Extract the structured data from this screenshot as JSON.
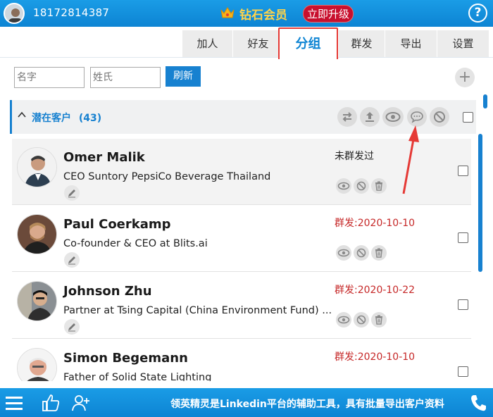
{
  "header": {
    "phone": "18172814387",
    "vip_label": "钻石会员",
    "upgrade_label": "立即升级",
    "help_label": "?"
  },
  "tabs": [
    {
      "label": "加人",
      "active": false
    },
    {
      "label": "好友",
      "active": false
    },
    {
      "label": "分组",
      "active": true
    },
    {
      "label": "群发",
      "active": false
    },
    {
      "label": "导出",
      "active": false
    },
    {
      "label": "设置",
      "active": false
    }
  ],
  "search": {
    "first_name_placeholder": "名字",
    "last_name_placeholder": "姓氏",
    "refresh_label": "刷新",
    "add_label": "+"
  },
  "group": {
    "title": "潜在客户",
    "count": "(43)"
  },
  "contacts": [
    {
      "name": "Omer Malik",
      "title": "CEO Suntory PepsiCo Beverage Thailand",
      "status": "未群发过",
      "status_type": "none"
    },
    {
      "name": "Paul Coerkamp",
      "title": "Co-founder & CEO at Blits.ai",
      "status": "群发:2020-10-10",
      "status_type": "sent"
    },
    {
      "name": "Johnson Zhu",
      "title": "Partner at Tsing Capital (China Environment Fund) ...",
      "status": "群发:2020-10-22",
      "status_type": "sent"
    },
    {
      "name": "Simon Begemann",
      "title": "Father of Solid State Lighting",
      "status": "群发:2020-10-10",
      "status_type": "sent"
    }
  ],
  "footer": {
    "text": "领英精灵是Linkedin平台的辅助工具，具有批量导出客户资料"
  },
  "colors": {
    "brand_blue": "#1781d0",
    "accent_red": "#c62828",
    "gold": "#ffd34a"
  }
}
